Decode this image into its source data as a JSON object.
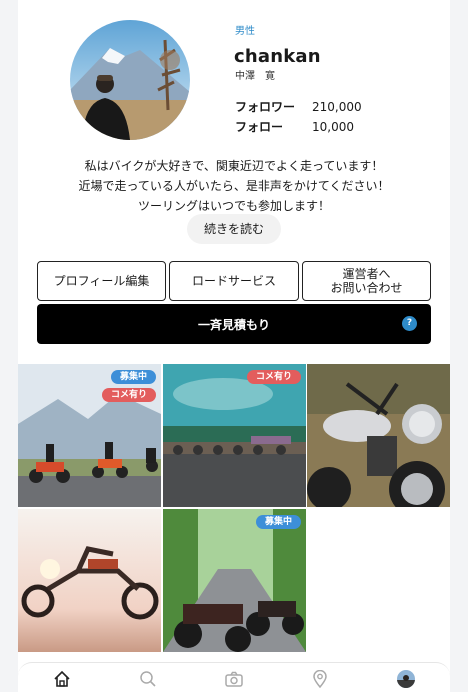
{
  "profile": {
    "gender": "男性",
    "username": "chankan",
    "real_name": "中澤　寛",
    "stats": [
      {
        "label": "フォロワー",
        "value": "210,000"
      },
      {
        "label": "フォロー",
        "value": "10,000"
      }
    ],
    "bio_lines": [
      "私はバイクが大好きで、関東近辺でよく走っています！",
      "近場で走っている人がいたら、是非声をかけてください！",
      "ツーリングはいつでも参加します！"
    ],
    "read_more": "続きを読む"
  },
  "actions": {
    "edit_profile": "プロフィール編集",
    "road_service": "ロードサービス",
    "contact_line1": "運営者へ",
    "contact_line2": "お問い合わせ",
    "bulk_quote": "一斉見積もり",
    "help_symbol": "?"
  },
  "posts": [
    {
      "badges": [
        "募集中",
        "コメ有り"
      ]
    },
    {
      "badges": [
        "コメ有り"
      ]
    },
    {
      "badges": []
    },
    {
      "badges": []
    },
    {
      "badges": [
        "募集中"
      ]
    }
  ],
  "badge_colors": {
    "募集中": "#3d8fd8",
    "コメ有り": "#e35d5d"
  },
  "tabbar": {
    "icons": [
      "home-icon",
      "search-icon",
      "camera-icon",
      "map-pin-icon",
      "profile-avatar-icon"
    ]
  }
}
